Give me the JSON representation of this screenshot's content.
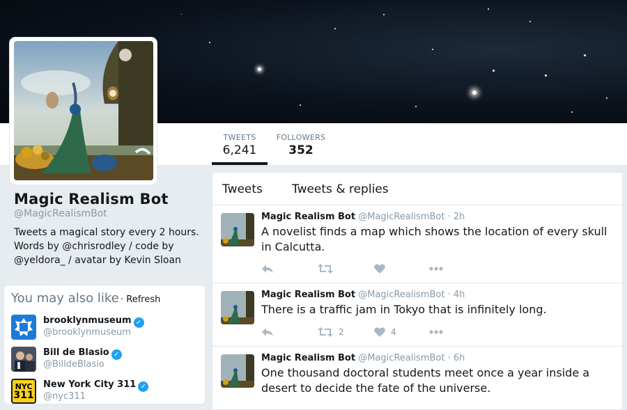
{
  "stats": [
    {
      "label": "TWEETS",
      "value": "6,241",
      "active": true
    },
    {
      "label": "FOLLOWERS",
      "value": "352",
      "active": false
    }
  ],
  "profile": {
    "name": "Magic Realism Bot",
    "handle": "@MagicRealismBot",
    "bio_line1": "Tweets a magical story every 2 hours.",
    "bio_words_by": "Words by ",
    "bio_author1": "@chrisrodley",
    "bio_code_by": " / code by",
    "bio_author2": "@yeldora_",
    "bio_avatar_by": " / avatar by Kevin Sloan"
  },
  "suggestions": {
    "title": "You may also like",
    "refresh": "· Refresh",
    "items": [
      {
        "name": "brooklynmuseum",
        "handle": "@brooklynmuseum",
        "verified": true,
        "avatar": "brooklyn-museum-logo"
      },
      {
        "name": "Bill de Blasio",
        "handle": "@BilldeBlasio",
        "verified": true,
        "avatar": "person-photo"
      },
      {
        "name": "New York City 311",
        "handle": "@nyc311",
        "verified": true,
        "avatar": "nyc-311-logo",
        "avatar_text": "NYC\n311"
      }
    ]
  },
  "timeline": {
    "tabs": [
      "Tweets",
      "Tweets & replies"
    ],
    "tweets": [
      {
        "name": "Magic Realism Bot",
        "handle": "@MagicRealismBot",
        "sep": " · ",
        "time": "2h",
        "text": "A novelist finds a map which shows the location of every skull in Calcutta.",
        "retweets": "",
        "likes": ""
      },
      {
        "name": "Magic Realism Bot",
        "handle": "@MagicRealismBot",
        "sep": " · ",
        "time": "4h",
        "text": "There is a traffic jam in Tokyo that is infinitely long.",
        "retweets": "2",
        "likes": "4"
      },
      {
        "name": "Magic Realism Bot",
        "handle": "@MagicRealismBot",
        "sep": " · ",
        "time": "6h",
        "text": "One thousand doctoral students meet once a year inside a desert to decide the fate of the universe.",
        "retweets": "",
        "likes": ""
      }
    ]
  },
  "icons": {
    "reply": "reply-icon",
    "retweet": "retweet-icon",
    "like": "heart-icon",
    "more": "more-icon",
    "verified": "verified-badge-icon"
  },
  "colors": {
    "accent": "#1da1f2",
    "muted": "#8899a6",
    "icon": "#aab8c2",
    "background": "#e6ecf0"
  }
}
